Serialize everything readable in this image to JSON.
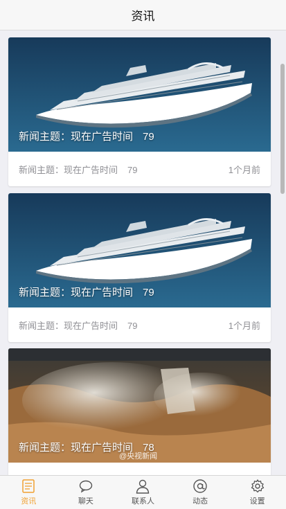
{
  "header": {
    "title": "资讯"
  },
  "news": [
    {
      "image": "cruise-ship",
      "title": "新闻主题：现在广告时间",
      "count": "79",
      "time": "1个月前"
    },
    {
      "image": "cruise-ship",
      "title": "新闻主题：现在广告时间",
      "count": "79",
      "time": "1个月前"
    },
    {
      "image": "waterfall",
      "title": "新闻主题：现在广告时间",
      "count": "78",
      "watermark": "@央视新闻"
    }
  ],
  "tabs": [
    {
      "label": "资讯",
      "icon": "news-icon",
      "active": true
    },
    {
      "label": "聊天",
      "icon": "chat-bubble-icon"
    },
    {
      "label": "联系人",
      "icon": "person-icon"
    },
    {
      "label": "动态",
      "icon": "at-sign-icon"
    },
    {
      "label": "设置",
      "icon": "gear-icon"
    }
  ],
  "colors": {
    "accent": "#f0a030",
    "tab_text": "#555555",
    "meta_text": "#8f8f94"
  }
}
